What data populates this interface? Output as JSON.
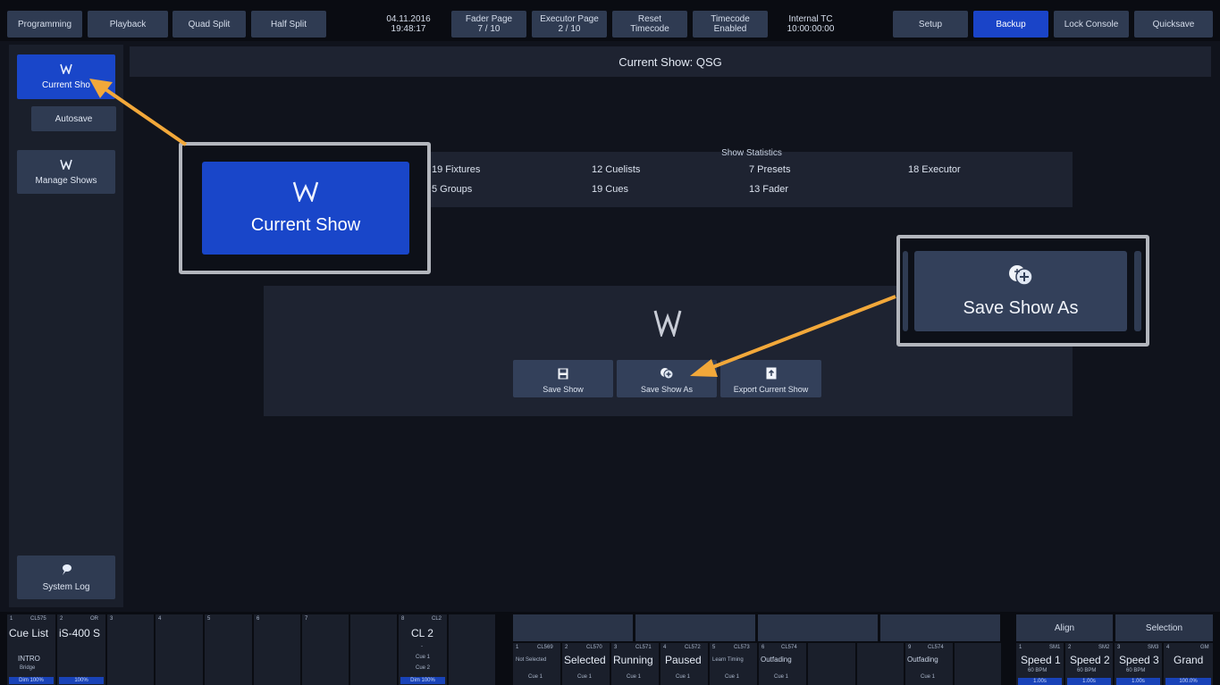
{
  "topbar": {
    "programming": "Programming",
    "playback": "Playback",
    "quad_split": "Quad Split",
    "half_split": "Half Split",
    "datetime": "04.11.2016\n19:48:17",
    "fader_page": "Fader Page\n7 / 10",
    "executor_page": "Executor Page\n2 / 10",
    "reset_timecode": "Reset\nTimecode",
    "timecode": "Timecode\nEnabled",
    "internal_tc": "Internal TC\n10:00:00:00",
    "setup": "Setup",
    "backup": "Backup",
    "lock_console": "Lock Console",
    "quicksave": "Quicksave"
  },
  "sidebar": {
    "current_show": "Current Sho",
    "autosave": "Autosave",
    "manage_shows": "Manage Shows",
    "system_log": "System Log"
  },
  "main": {
    "title": "Current Show: QSG",
    "stats_header": "Show Statistics",
    "stats": {
      "fixtures": "19 Fixtures",
      "cuelists": "12 Cuelists",
      "presets": "7 Presets",
      "executor": "18 Executor",
      "groups": "5 Groups",
      "cues": "19 Cues",
      "fader": "13 Fader"
    },
    "actions": {
      "save_show": "Save Show",
      "save_show_as": "Save Show As",
      "export_show": "Export Current Show"
    }
  },
  "callouts": {
    "current_show": "Current Show",
    "save_show_as": "Save Show As"
  },
  "playbacks": {
    "p1": {
      "num": "1",
      "id": "CL575",
      "name": "Cue List",
      "cue": "INTRO",
      "next": "Bridge",
      "dim": "Dim 100%"
    },
    "p2": {
      "num": "2",
      "id": "OR",
      "name": "iS-400 S",
      "dim": "100%"
    },
    "p3": {
      "num": "3"
    },
    "p4": {
      "num": "4"
    },
    "p5": {
      "num": "5"
    },
    "p6": {
      "num": "6"
    },
    "p7": {
      "num": "7"
    },
    "p8": {
      "num": "8",
      "id": "CL2",
      "name": "CL 2",
      "dash": "-",
      "cue": "Cue 1",
      "next": "Cue 2",
      "dim": "Dim 100%"
    },
    "status": [
      {
        "num": "1",
        "id": "CL569",
        "label": "Not Selected",
        "cue": "Cue 1"
      },
      {
        "num": "2",
        "id": "CL570",
        "label": "Selected",
        "cue": "Cue 1"
      },
      {
        "num": "3",
        "id": "CL571",
        "label": "Running",
        "cue": "Cue 1"
      },
      {
        "num": "4",
        "id": "CL572",
        "label": "Paused",
        "cue": "Cue 1"
      },
      {
        "num": "5",
        "id": "CL573",
        "label": "Learn Timing",
        "cue": "Cue 1"
      },
      {
        "num": "6",
        "id": "CL574",
        "label": "Outfading",
        "cue": "Cue 1"
      },
      {
        "num": "9",
        "id": "CL574",
        "label": "Outfading",
        "cue": "Cue 1"
      }
    ],
    "align": "Align",
    "selection": "Selection",
    "speeds": [
      {
        "num": "1",
        "id": "SM1",
        "label": "Speed 1",
        "bpm": "60 BPM",
        "time": "1.00s"
      },
      {
        "num": "2",
        "id": "SM2",
        "label": "Speed 2",
        "bpm": "60 BPM",
        "time": "1.00s"
      },
      {
        "num": "3",
        "id": "SM3",
        "label": "Speed 3",
        "bpm": "60 BPM",
        "time": "1.00s"
      },
      {
        "num": "4",
        "id": "GM",
        "label": "Grand",
        "val": "100.0%"
      }
    ]
  },
  "colors": {
    "accent_blue": "#1a44c8",
    "arrow_orange": "#f2a83a",
    "button": "#2f3b52"
  }
}
